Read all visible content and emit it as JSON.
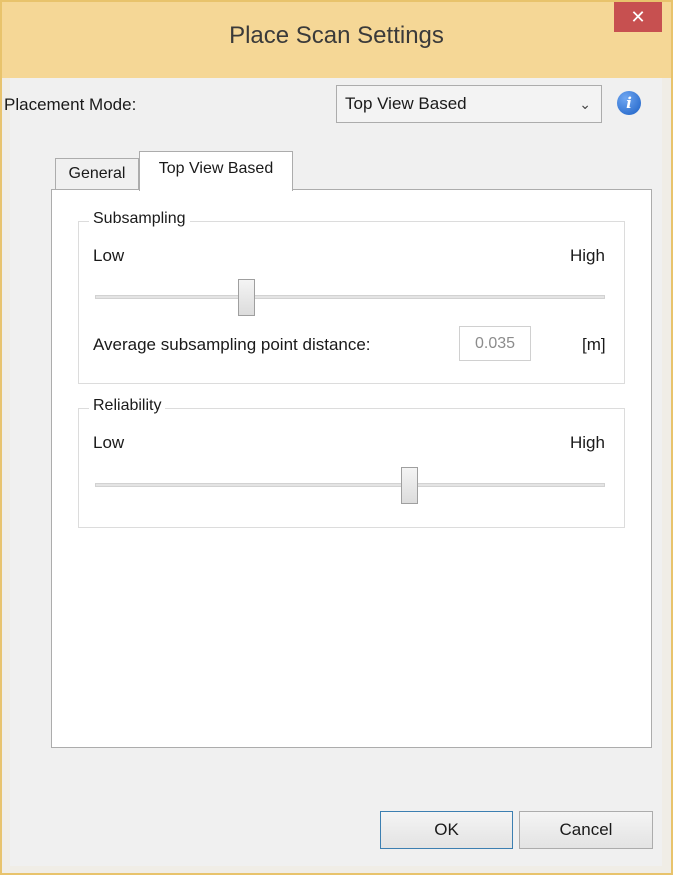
{
  "window": {
    "title": "Place Scan Settings",
    "close_glyph": "✕"
  },
  "placement": {
    "label": "Placement Mode:",
    "selected": "Top View Based",
    "chevron": "⌄",
    "info_glyph": "i"
  },
  "tabs": [
    {
      "label": "General",
      "active": false
    },
    {
      "label": "Top View Based",
      "active": true
    }
  ],
  "subsampling": {
    "title": "Subsampling",
    "low_label": "Low",
    "high_label": "High",
    "slider_level": 0.29,
    "distance_label": "Average subsampling point distance:",
    "distance_value": "0.035",
    "unit": "[m]"
  },
  "reliability": {
    "title": "Reliability",
    "low_label": "Low",
    "high_label": "High",
    "slider_level": 0.62
  },
  "buttons": {
    "ok": "OK",
    "cancel": "Cancel"
  },
  "colors": {
    "titlebar": "#f5d796",
    "close": "#c75050",
    "info": "#1b5fc4"
  }
}
